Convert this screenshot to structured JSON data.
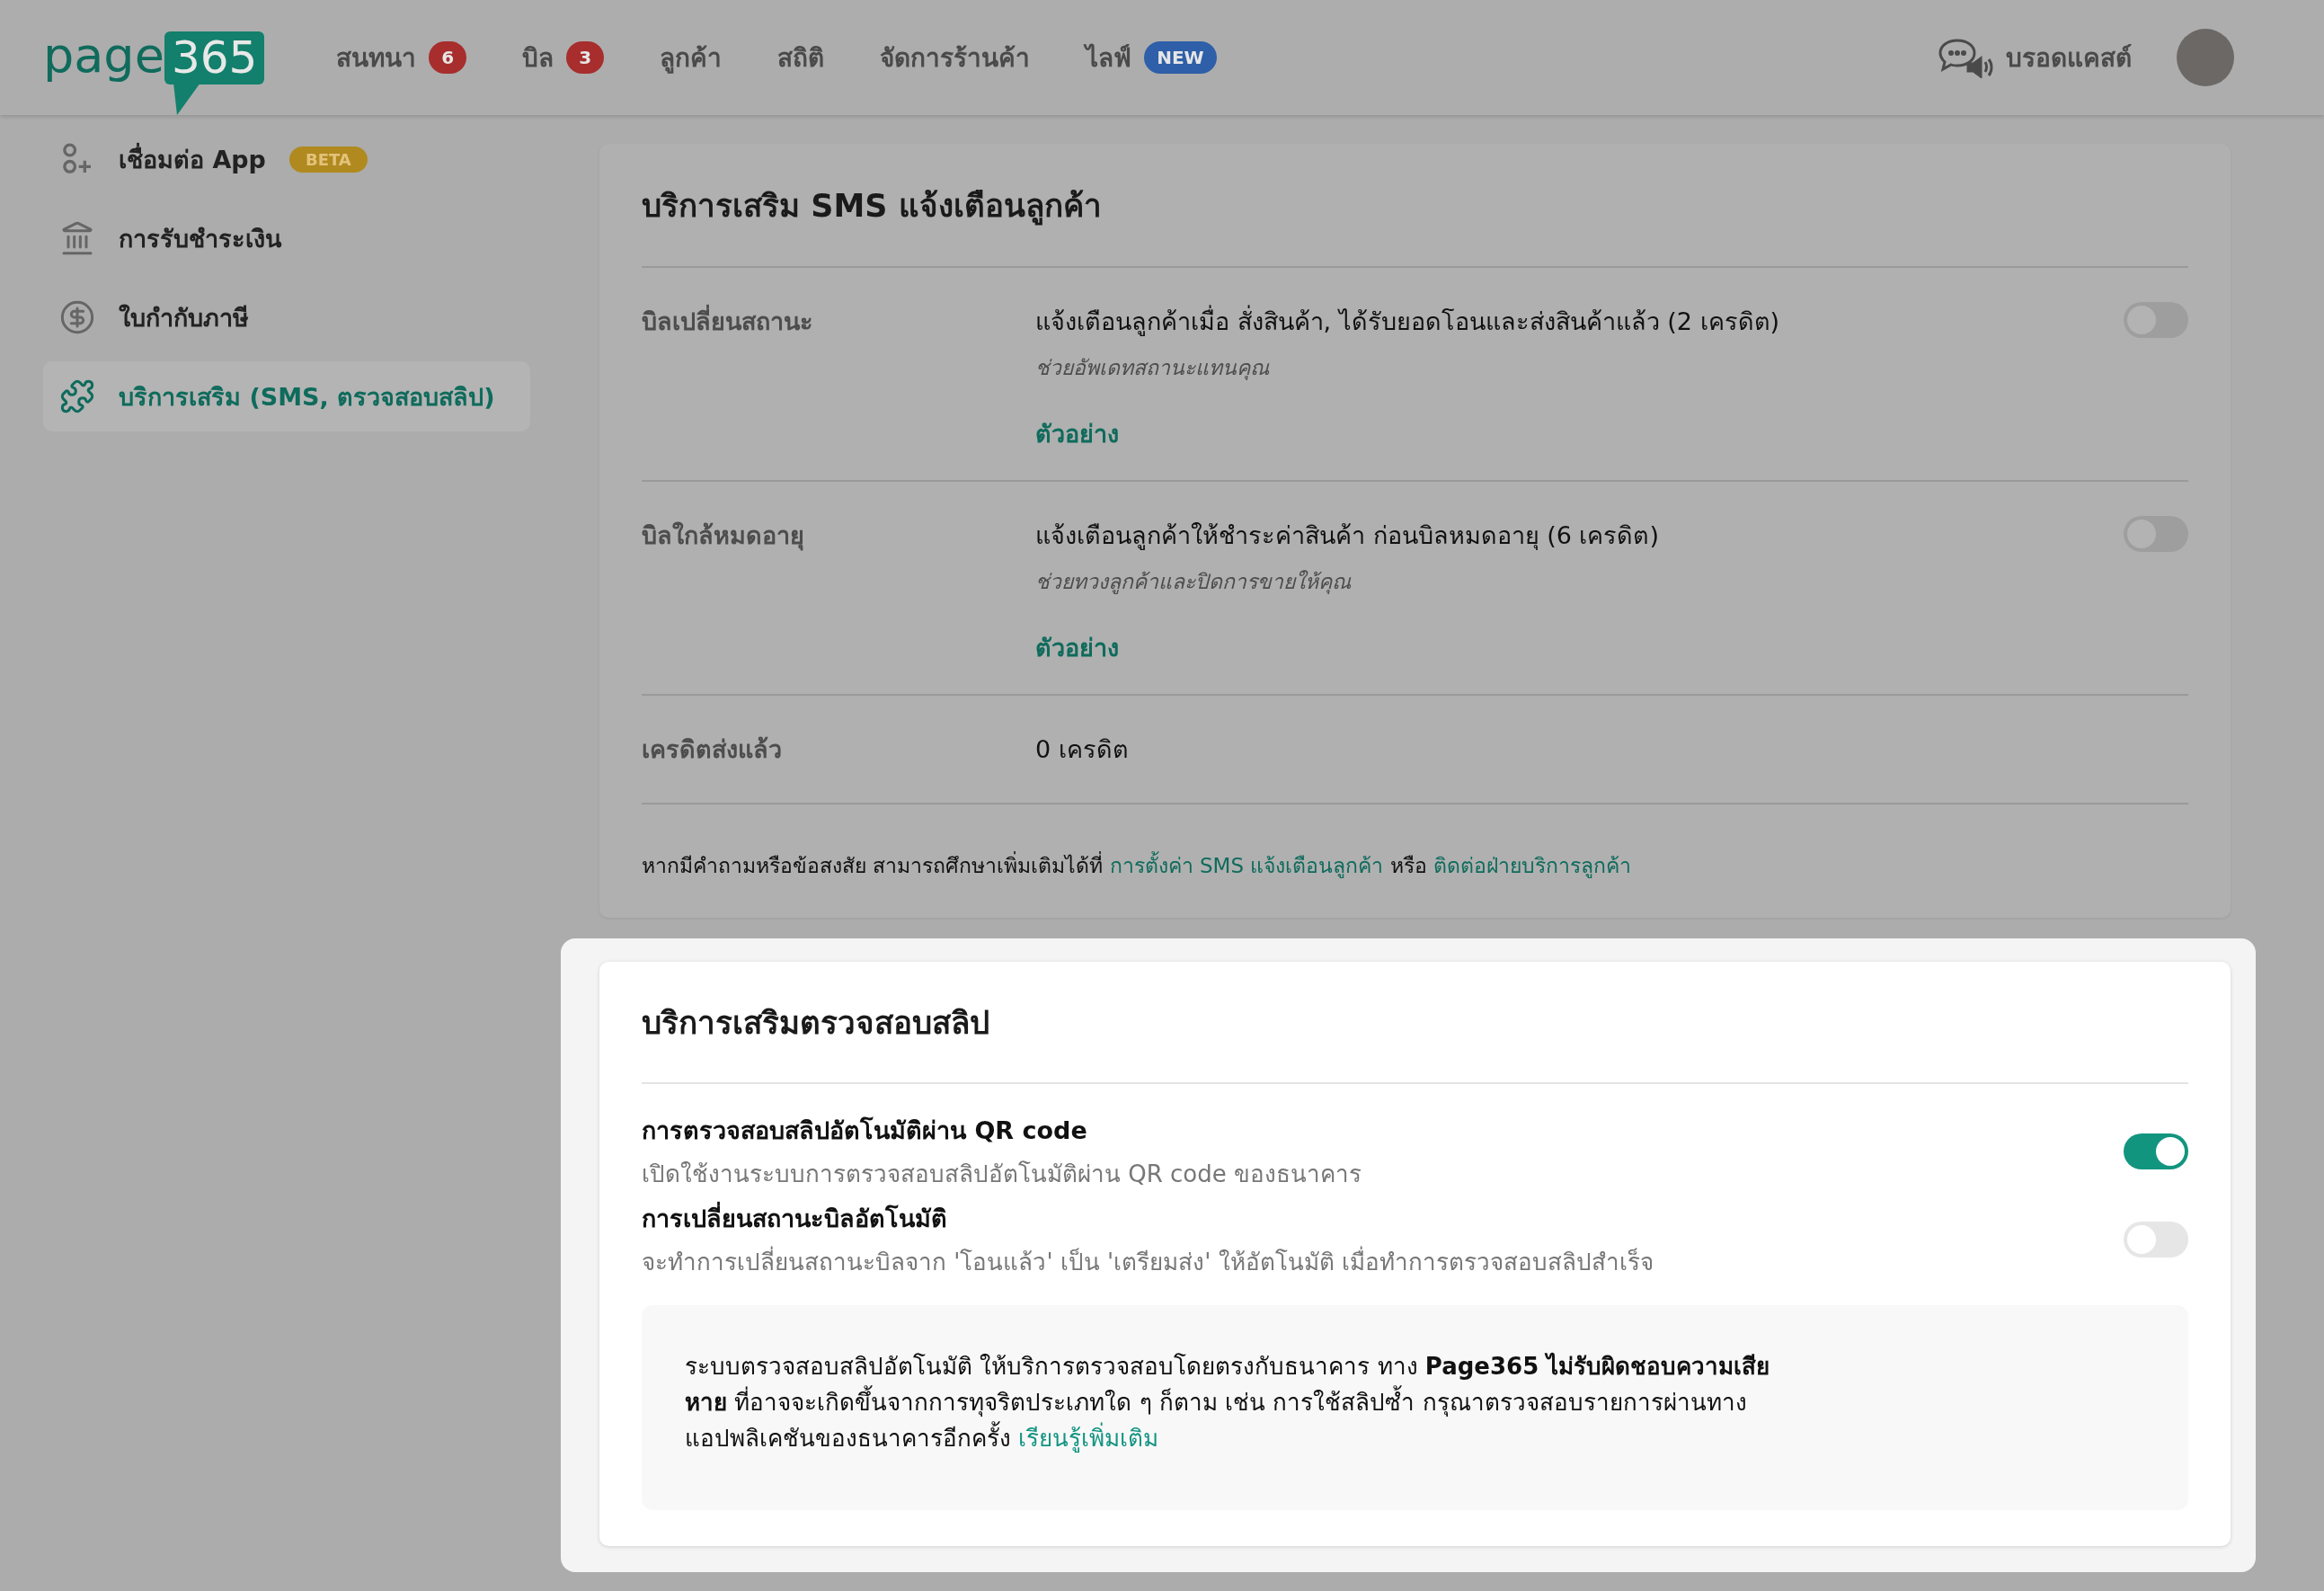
{
  "header": {
    "logo": {
      "word": "page",
      "number": "365"
    },
    "nav": [
      {
        "label": "สนทนา",
        "badge": "6",
        "kind": "count"
      },
      {
        "label": "บิล",
        "badge": "3",
        "kind": "count"
      },
      {
        "label": "ลูกค้า"
      },
      {
        "label": "สถิติ"
      },
      {
        "label": "จัดการร้านค้า"
      },
      {
        "label": "ไลฟ์",
        "badge": "NEW",
        "kind": "new"
      }
    ],
    "broadcast": "บรอดแคสต์"
  },
  "sidebar": {
    "items": [
      {
        "label": "เชื่อมต่อ App",
        "badge": "BETA",
        "kind": "users",
        "selected": false
      },
      {
        "label": "การรับชำระเงิน",
        "kind": "bank",
        "selected": false
      },
      {
        "label": "ใบกำกับภาษี",
        "kind": "dollar",
        "selected": false
      },
      {
        "label": "บริการเสริม (SMS, ตรวจสอบสลิป)",
        "kind": "puzzle",
        "selected": true
      }
    ]
  },
  "sms_card": {
    "title": "บริการเสริม SMS แจ้งเตือนลูกค้า",
    "rows": [
      {
        "label": "บิลเปลี่ยนสถานะ",
        "description": "แจ้งเตือนลูกค้าเมื่อ สั่งสินค้า, ได้รับยอดโอนและส่งสินค้าแล้ว (2 เครดิต)",
        "hint": "ช่วยอัพเดทสถานะแทนคุณ",
        "link": "ตัวอย่าง",
        "on": false
      },
      {
        "label": "บิลใกล้หมดอายุ",
        "description": "แจ้งเตือนลูกค้าให้ชำระค่าสินค้า ก่อนบิลหมดอายุ (6 เครดิต)",
        "hint": "ช่วยทวงลูกค้าและปิดการขายให้คุณ",
        "link": "ตัวอย่าง",
        "on": false
      }
    ],
    "credit": {
      "label": "เครดิตส่งแล้ว",
      "value": "0 เครดิต"
    },
    "footer": [
      {
        "kind": "text",
        "text": "หากมีคำถามหรือข้อสงสัย สามารถศึกษาเพิ่มเติมได้ที่"
      },
      {
        "kind": "link",
        "text": "การตั้งค่า SMS แจ้งเตือนลูกค้า"
      },
      {
        "kind": "text",
        "text": "หรือ"
      },
      {
        "kind": "link",
        "text": "ติดต่อฝ่ายบริการลูกค้า"
      }
    ]
  },
  "slip_card": {
    "title": "บริการเสริมตรวจสอบสลิป",
    "settings": [
      {
        "title": "การตรวจสอบสลิปอัตโนมัติผ่าน QR code",
        "description": "เปิดใช้งานระบบการตรวจสอบสลิปอัตโนมัติผ่าน QR code ของธนาคาร",
        "on": true
      },
      {
        "title": "การเปลี่ยนสถานะบิลอัตโนมัติ",
        "description": "จะทำการเปลี่ยนสถานะบิลจาก 'โอนแล้ว' เป็น 'เตรียมส่ง' ให้อัตโนมัติ เมื่อทำการตรวจสอบสลิปสำเร็จ",
        "on": false
      }
    ],
    "notice": {
      "text": "ระบบตรวจสอบสลิปอัตโนมัติ ให้บริการตรวจสอบโดยตรงกับธนาคาร ทาง **Page365 ไม่รับผิดชอบความเสียหาย** ที่อาจจะเกิดขึ้นจากการทุจริตประเภทใด ๆ ก็ตาม เช่น การใช้สลิปซ้ำ กรุณาตรวจสอบรายการผ่านทางแอปพลิเคชันของธนาคารอีกครั้ง",
      "link": "เรียนรู้เพิ่มเติม"
    }
  }
}
